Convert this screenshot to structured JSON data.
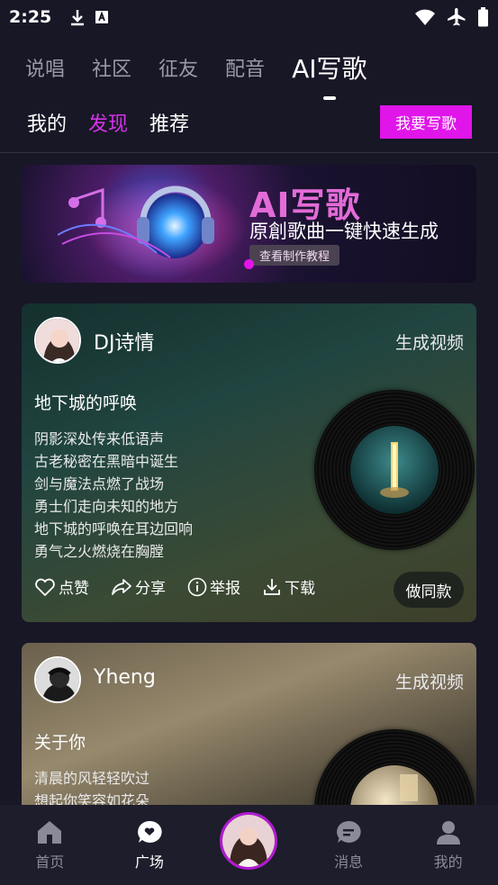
{
  "status_bar": {
    "time": "2:25",
    "icons_left": [
      "download-icon",
      "a-text-icon"
    ],
    "icons_right": [
      "wifi-icon",
      "airplane-icon",
      "battery-icon"
    ]
  },
  "top_tabs": [
    {
      "label": "说唱",
      "active": false
    },
    {
      "label": "社区",
      "active": false
    },
    {
      "label": "征友",
      "active": false
    },
    {
      "label": "配音",
      "active": false
    },
    {
      "label": "AI写歌",
      "active": true
    }
  ],
  "sub_tabs": [
    {
      "label": "我的",
      "active": false
    },
    {
      "label": "发现",
      "active": true
    },
    {
      "label": "推荐",
      "active": false
    }
  ],
  "write_button": "我要写歌",
  "banner": {
    "title": "AI写歌",
    "subtitle": "原創歌曲一键快速生成",
    "button": "查看制作教程"
  },
  "feed": [
    {
      "username": "DJ诗情",
      "generate_video": "生成视频",
      "song_title": "地下城的呼唤",
      "lyrics": [
        "阴影深处传来低语声",
        "古老秘密在黑暗中诞生",
        "剑与魔法点燃了战场",
        "勇士们走向未知的地方",
        "地下城的呼唤在耳边回响",
        "勇气之火燃烧在胸膛"
      ],
      "actions": {
        "like": "点赞",
        "share": "分享",
        "report": "举报",
        "download": "下载"
      },
      "same_button": "做同款"
    },
    {
      "username": "Yheng",
      "generate_video": "生成视频",
      "song_title": "关于你",
      "lyrics": [
        "清晨的风轻轻吹过",
        "想起你笑容如花朵"
      ]
    }
  ],
  "bottom_nav": [
    {
      "label": "首页",
      "icon": "home-icon",
      "active": false
    },
    {
      "label": "广场",
      "icon": "plaza-icon",
      "active": true
    },
    {
      "label": "",
      "icon": "center-avatar",
      "active": false
    },
    {
      "label": "消息",
      "icon": "message-icon",
      "active": false
    },
    {
      "label": "我的",
      "icon": "profile-icon",
      "active": false
    }
  ],
  "colors": {
    "accent": "#e015ea",
    "background": "#181726",
    "active_subtab": "#d433e8"
  }
}
